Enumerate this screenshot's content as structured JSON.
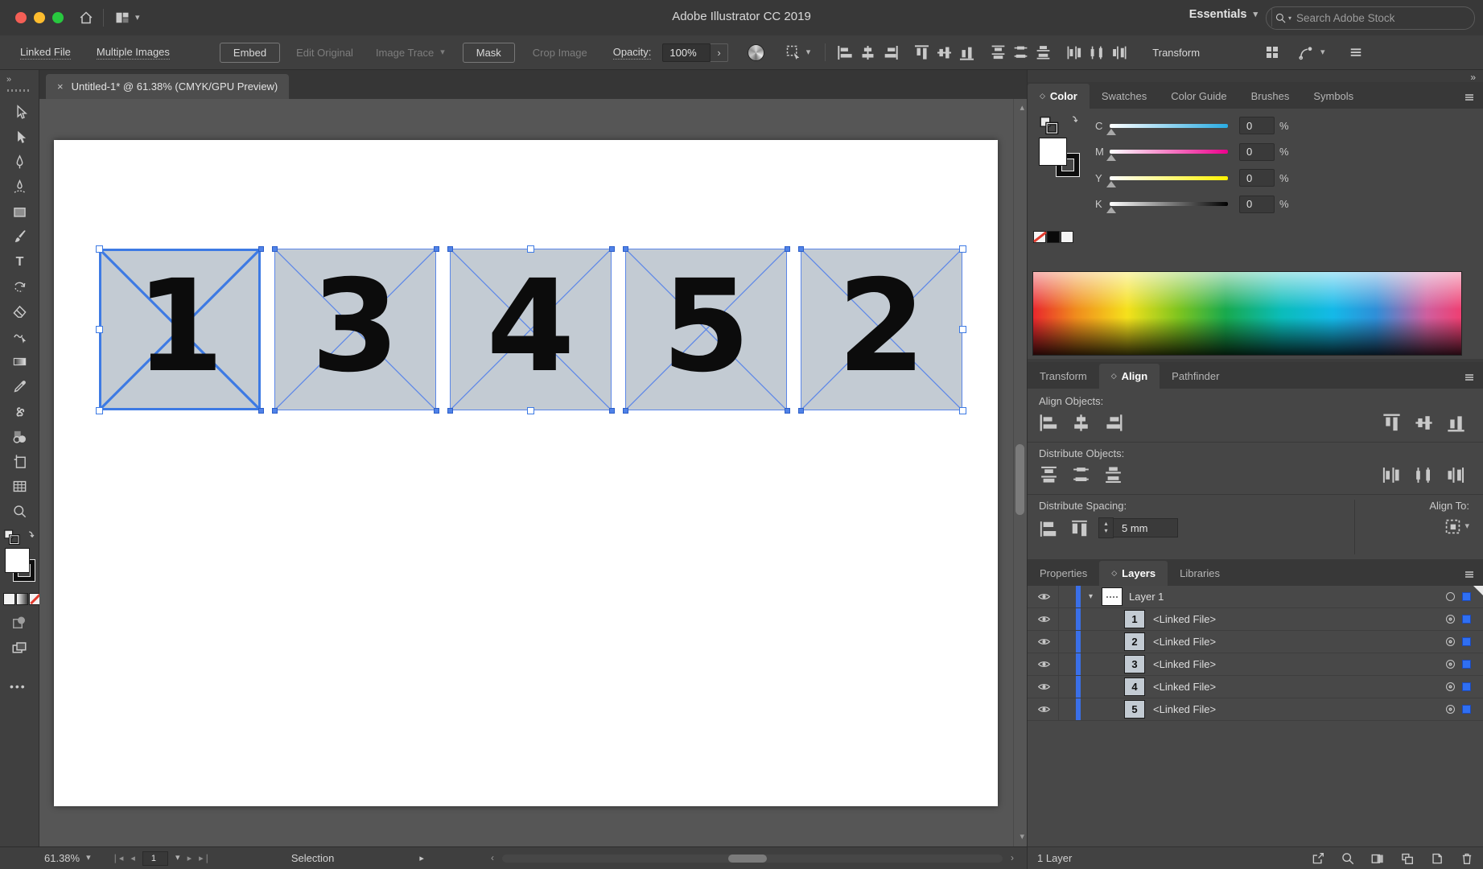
{
  "titlebar": {
    "title": "Adobe Illustrator CC 2019",
    "workspace": "Essentials",
    "search_placeholder": "Search Adobe Stock"
  },
  "controlbar": {
    "linked_file": "Linked File",
    "multiple_images": "Multiple Images",
    "embed": "Embed",
    "edit_original": "Edit Original",
    "image_trace": "Image Trace",
    "mask": "Mask",
    "crop_image": "Crop Image",
    "opacity_label": "Opacity:",
    "opacity_value": "100%",
    "transform_label": "Transform",
    "align_icons": [
      "align-left",
      "align-h-center",
      "align-right",
      "align-top",
      "align-v-center",
      "align-bottom",
      "distribute-top",
      "distribute-v-center",
      "distribute-bottom",
      "distribute-left",
      "distribute-h-center",
      "distribute-right"
    ]
  },
  "doctab": {
    "title": "Untitled-1* @ 61.38% (CMYK/GPU Preview)"
  },
  "toolbar": {
    "tools": [
      "selection-tool",
      "direct-selection-tool",
      "pen-tool",
      "curvature-tool",
      "rectangle-tool",
      "paintbrush-tool",
      "type-tool",
      "rotate-tool",
      "eraser-tool",
      "shaper-tool",
      "gradient-tool",
      "eyedropper-tool",
      "puppet-warp-tool",
      "shape-builder-tool",
      "artboard-tool",
      "perspective-grid-tool",
      "zoom-tool"
    ]
  },
  "canvas": {
    "squares": [
      {
        "label": "1",
        "selected": true
      },
      {
        "label": "3",
        "selected": false
      },
      {
        "label": "4",
        "selected": false
      },
      {
        "label": "5",
        "selected": false
      },
      {
        "label": "2",
        "selected": false
      }
    ]
  },
  "color_panel": {
    "tabs": [
      "Color",
      "Swatches",
      "Color Guide",
      "Brushes",
      "Symbols"
    ],
    "active_tab": "Color",
    "channels": [
      {
        "label": "C",
        "value": "0",
        "unit": "%",
        "track": "track-c"
      },
      {
        "label": "M",
        "value": "0",
        "unit": "%",
        "track": "track-m"
      },
      {
        "label": "Y",
        "value": "0",
        "unit": "%",
        "track": "track-y"
      },
      {
        "label": "K",
        "value": "0",
        "unit": "%",
        "track": "track-k"
      }
    ]
  },
  "align_panel": {
    "tabs": [
      "Transform",
      "Align",
      "Pathfinder"
    ],
    "active_tab": "Align",
    "align_objects_label": "Align Objects:",
    "distribute_objects_label": "Distribute Objects:",
    "distribute_spacing_label": "Distribute Spacing:",
    "align_to_label": "Align To:",
    "spacing_value": "5 mm",
    "align_left_icons": [
      "align-left",
      "align-h-center",
      "align-right"
    ],
    "align_right_icons": [
      "align-top",
      "align-v-center",
      "align-bottom"
    ],
    "dist_left_icons": [
      "distribute-top",
      "distribute-v-center",
      "distribute-bottom"
    ],
    "dist_right_icons": [
      "distribute-left",
      "distribute-h-center",
      "distribute-right"
    ],
    "spacing_icons": [
      "vertical-distribute-space",
      "horizontal-distribute-space"
    ]
  },
  "layers_panel": {
    "tabs": [
      "Properties",
      "Layers",
      "Libraries"
    ],
    "active_tab": "Layers",
    "parent_layer": {
      "name": "Layer 1"
    },
    "items": [
      {
        "thumb": "1",
        "label": "<Linked File>"
      },
      {
        "thumb": "2",
        "label": "<Linked File>"
      },
      {
        "thumb": "3",
        "label": "<Linked File>"
      },
      {
        "thumb": "4",
        "label": "<Linked File>"
      },
      {
        "thumb": "5",
        "label": "<Linked File>"
      }
    ],
    "footer": "1 Layer"
  },
  "statusbar": {
    "zoom_level": "61.38%",
    "artboard_value": "1",
    "status": "Selection"
  }
}
